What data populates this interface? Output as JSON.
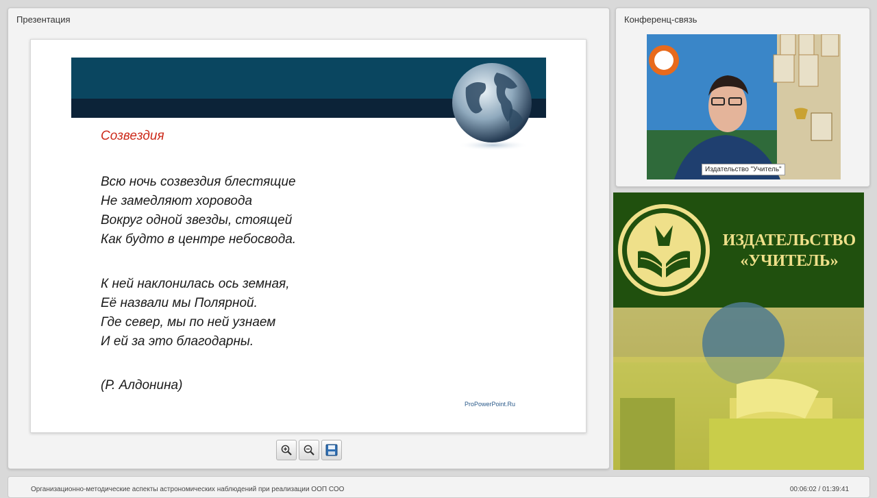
{
  "presentation_panel": {
    "title": "Презентация",
    "slide": {
      "heading": "Созвездия",
      "stanza1": [
        "Всю ночь созвездия блестящие",
        "Не замедляют хоровода",
        "Вокруг одной звезды, стоящей",
        "Как будто в центре небосвода."
      ],
      "stanza2": [
        "К ней наклонилась ось земная,",
        "Её назвали мы Полярной.",
        "Где север, мы по ней узнаем",
        "И ей за это благодарны."
      ],
      "author": "(Р. Алдонина)",
      "watermark": "ProPowerPoint.Ru"
    },
    "toolbar": {
      "zoom_in_icon": "zoom-in-icon",
      "zoom_out_icon": "zoom-out-icon",
      "save_icon": "floppy-disk-icon"
    }
  },
  "conference_panel": {
    "title": "Конференц-связь",
    "video_label": "Издательство \"Учитель\""
  },
  "publisher_banner": {
    "name_line1": "ИЗДАТЕЛЬСТВО",
    "name_line2": "«УЧИТЕЛЬ»"
  },
  "footer": {
    "lecture_title": "Организационно-методические аспекты астрономических наблюдений при реализации ООП СОО",
    "time": "00:06:02 / 01:39:41"
  },
  "colors": {
    "heading_red": "#cc2a1a",
    "banner_blue": "#0a4660",
    "publisher_green": "#20500e",
    "publisher_gold": "#efe08a"
  }
}
